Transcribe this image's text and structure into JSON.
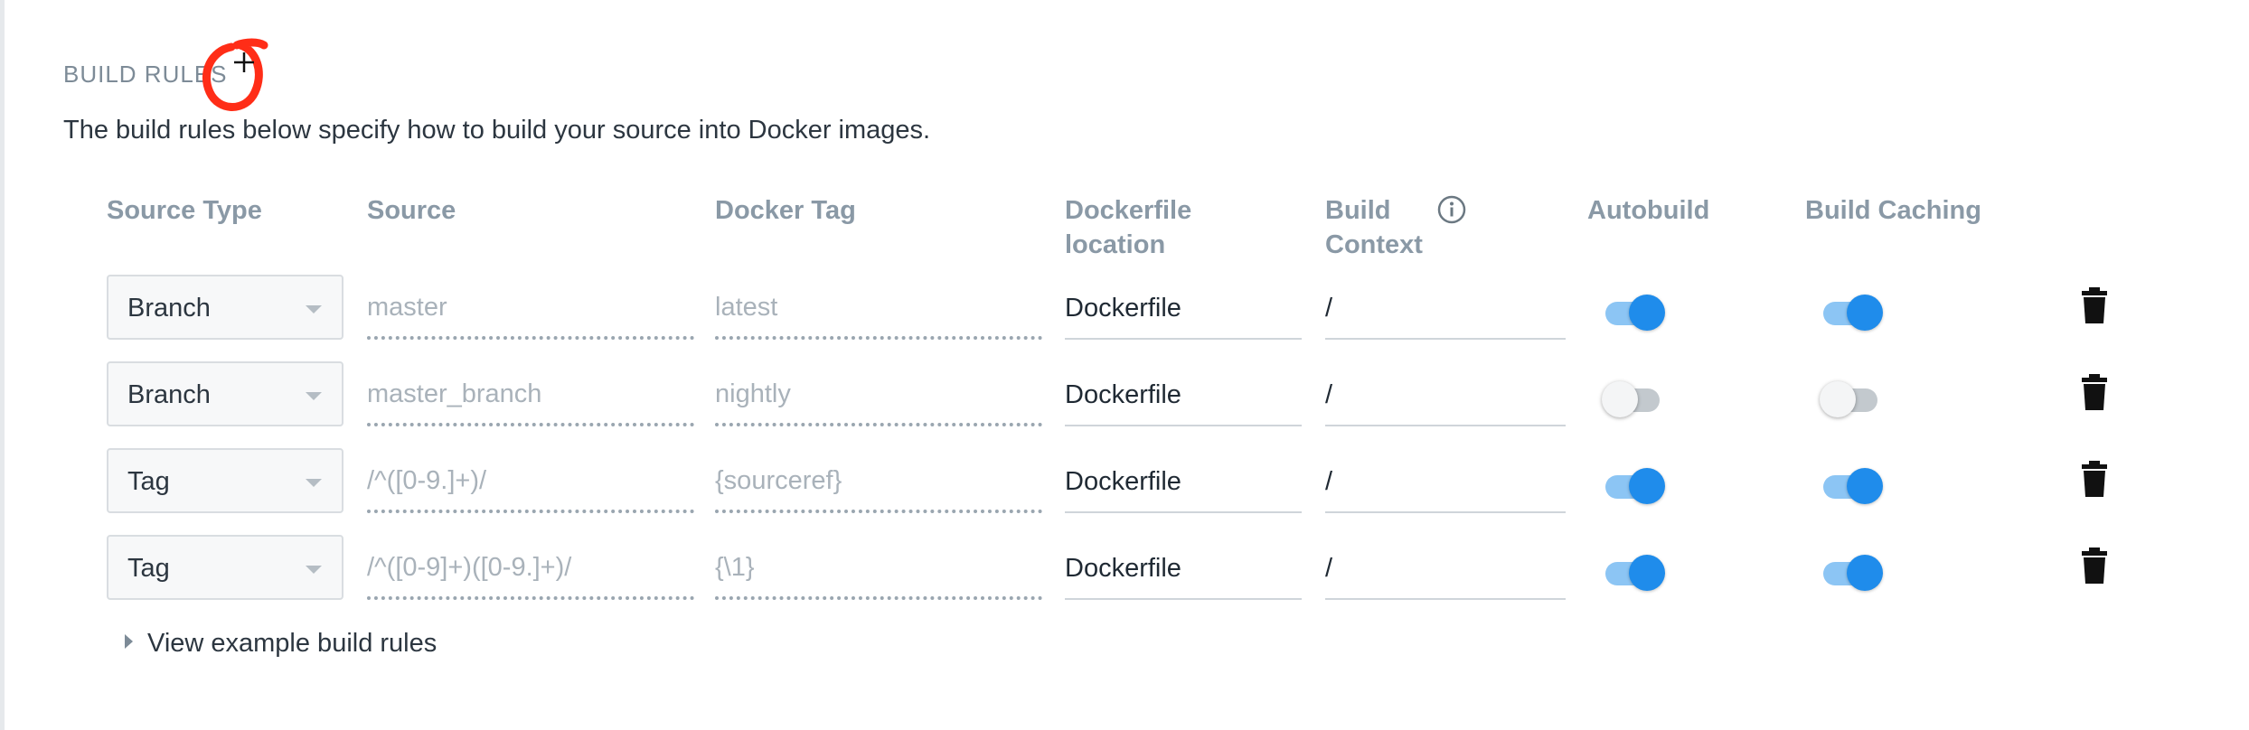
{
  "section": {
    "title": "BUILD RULES",
    "description": "The build rules below specify how to build your source into Docker images."
  },
  "columns": {
    "source_type": "Source Type",
    "source": "Source",
    "docker_tag": "Docker Tag",
    "dockerfile_location": [
      "Dockerfile",
      "location"
    ],
    "build_context": [
      "Build",
      "Context"
    ],
    "autobuild": "Autobuild",
    "build_caching": "Build Caching"
  },
  "rows": [
    {
      "source_type": "Branch",
      "source_placeholder": "master",
      "tag_placeholder": "latest",
      "dockerfile": "Dockerfile",
      "context": "/",
      "autobuild": true,
      "build_caching": true
    },
    {
      "source_type": "Branch",
      "source_placeholder": "master_branch",
      "tag_placeholder": "nightly",
      "dockerfile": "Dockerfile",
      "context": "/",
      "autobuild": false,
      "build_caching": false
    },
    {
      "source_type": "Tag",
      "source_placeholder": "/^([0-9.]+)/",
      "tag_placeholder": "{sourceref}",
      "dockerfile": "Dockerfile",
      "context": "/",
      "autobuild": true,
      "build_caching": true
    },
    {
      "source_type": "Tag",
      "source_placeholder": "/^([0-9]+)([0-9.]+)/",
      "tag_placeholder": "{\\1}",
      "dockerfile": "Dockerfile",
      "context": "/",
      "autobuild": true,
      "build_caching": true
    }
  ],
  "footer": {
    "view_examples": "View example build rules"
  },
  "icons": {
    "add": "plus-icon",
    "info": "info-circle-icon",
    "delete": "trash-icon",
    "select": "caret-down-icon",
    "expand": "triangle-right-icon"
  },
  "colors": {
    "toggle_on": "#1f8ceb",
    "header_text": "#8a99a6",
    "annotation": "#ff2d17"
  }
}
